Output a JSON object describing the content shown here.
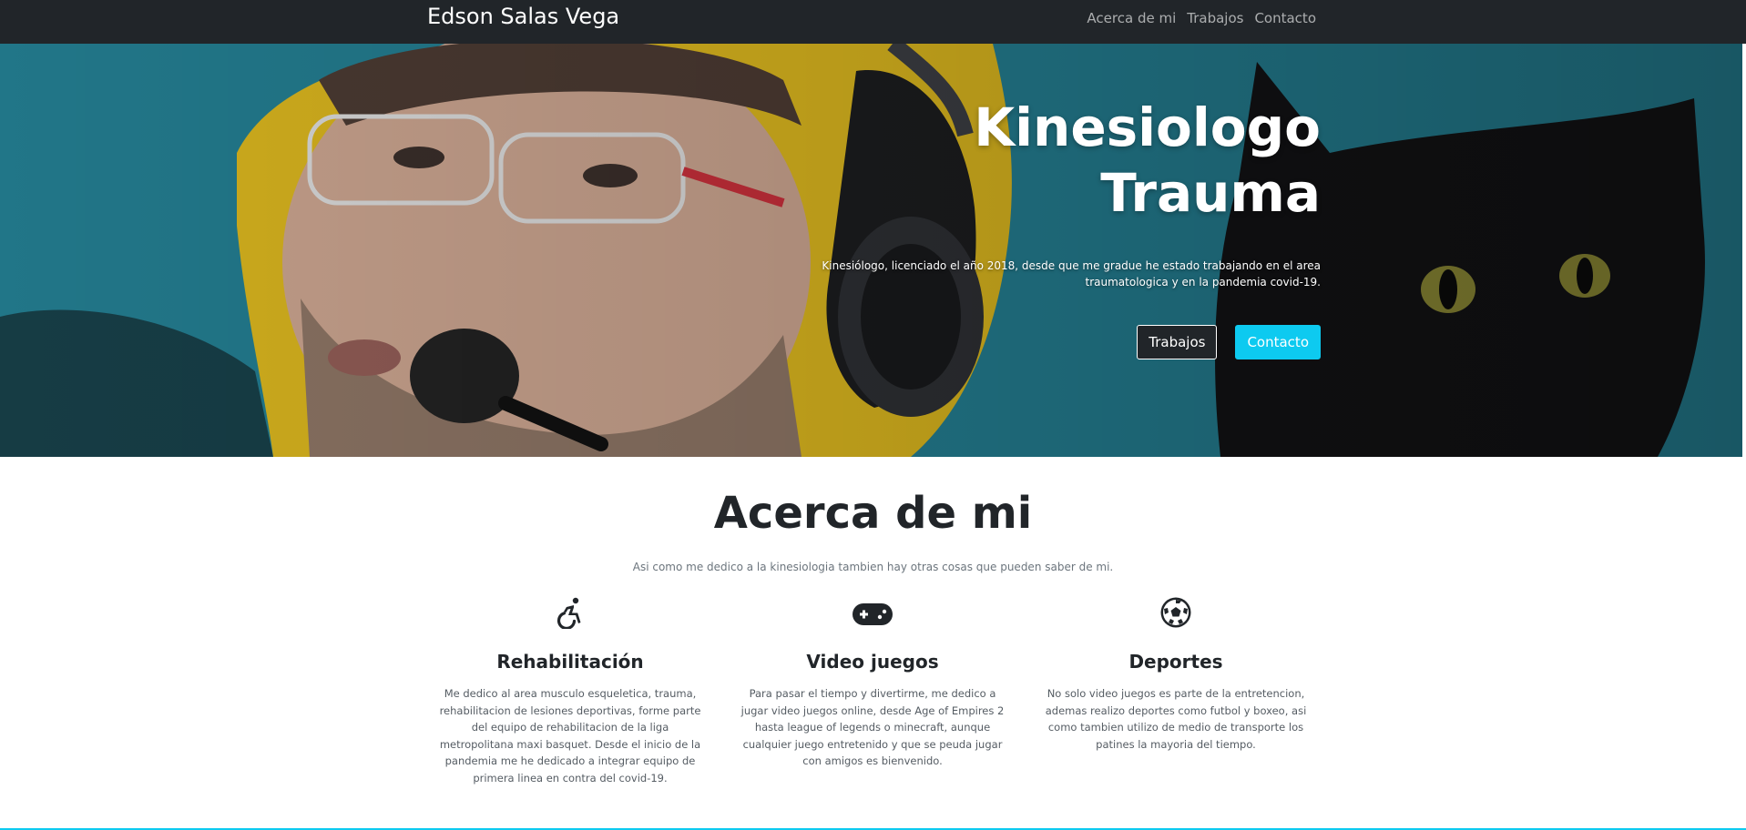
{
  "navbar": {
    "brand": "Edson Salas Vega",
    "links": [
      "Acerca de mi",
      "Trabajos",
      "Contacto"
    ]
  },
  "hero": {
    "title_line1": "Kinesiologo",
    "title_line2": "Trauma",
    "description_line1": "Kinesiólogo, licenciado el año 2018, desde que me gradue he estado trabajando en el area",
    "description_line2": "traumatologica y en la pandemia covid-19.",
    "buttons": {
      "trabajos": "Trabajos",
      "contacto": "Contacto"
    }
  },
  "about": {
    "title": "Acerca de mi",
    "subtitle": "Asi como me dedico a la kinesiologia tambien hay otras cosas que pueden saber de mi.",
    "features": [
      {
        "icon": "wheelchair-icon",
        "title": "Rehabilitación",
        "text": "Me dedico al area musculo esqueletica, trauma, rehabilitacion de lesiones deportivas, forme parte del equipo de rehabilitacion de la liga metropolitana maxi basquet. Desde el inicio de la pandemia me he dedicado a integrar equipo de primera linea en contra del covid-19."
      },
      {
        "icon": "gamepad-icon",
        "title": "Video juegos",
        "text": "Para pasar el tiempo y divertirme, me dedico a jugar video juegos online, desde Age of Empires 2 hasta league of legends o minecraft, aunque cualquier juego entretenido y que se peuda jugar con amigos es bienvenido."
      },
      {
        "icon": "soccer-ball-icon",
        "title": "Deportes",
        "text": "No solo video juegos es parte de la entretencion, ademas realizo deportes como futbol y boxeo, asi como tambien utilizo de medio de transporte los patines la mayoria del tiempo."
      }
    ]
  },
  "colors": {
    "navbar_bg": "#212529",
    "accent": "#0dcaf0",
    "text_dark": "#212529",
    "text_muted": "#6c757d"
  }
}
